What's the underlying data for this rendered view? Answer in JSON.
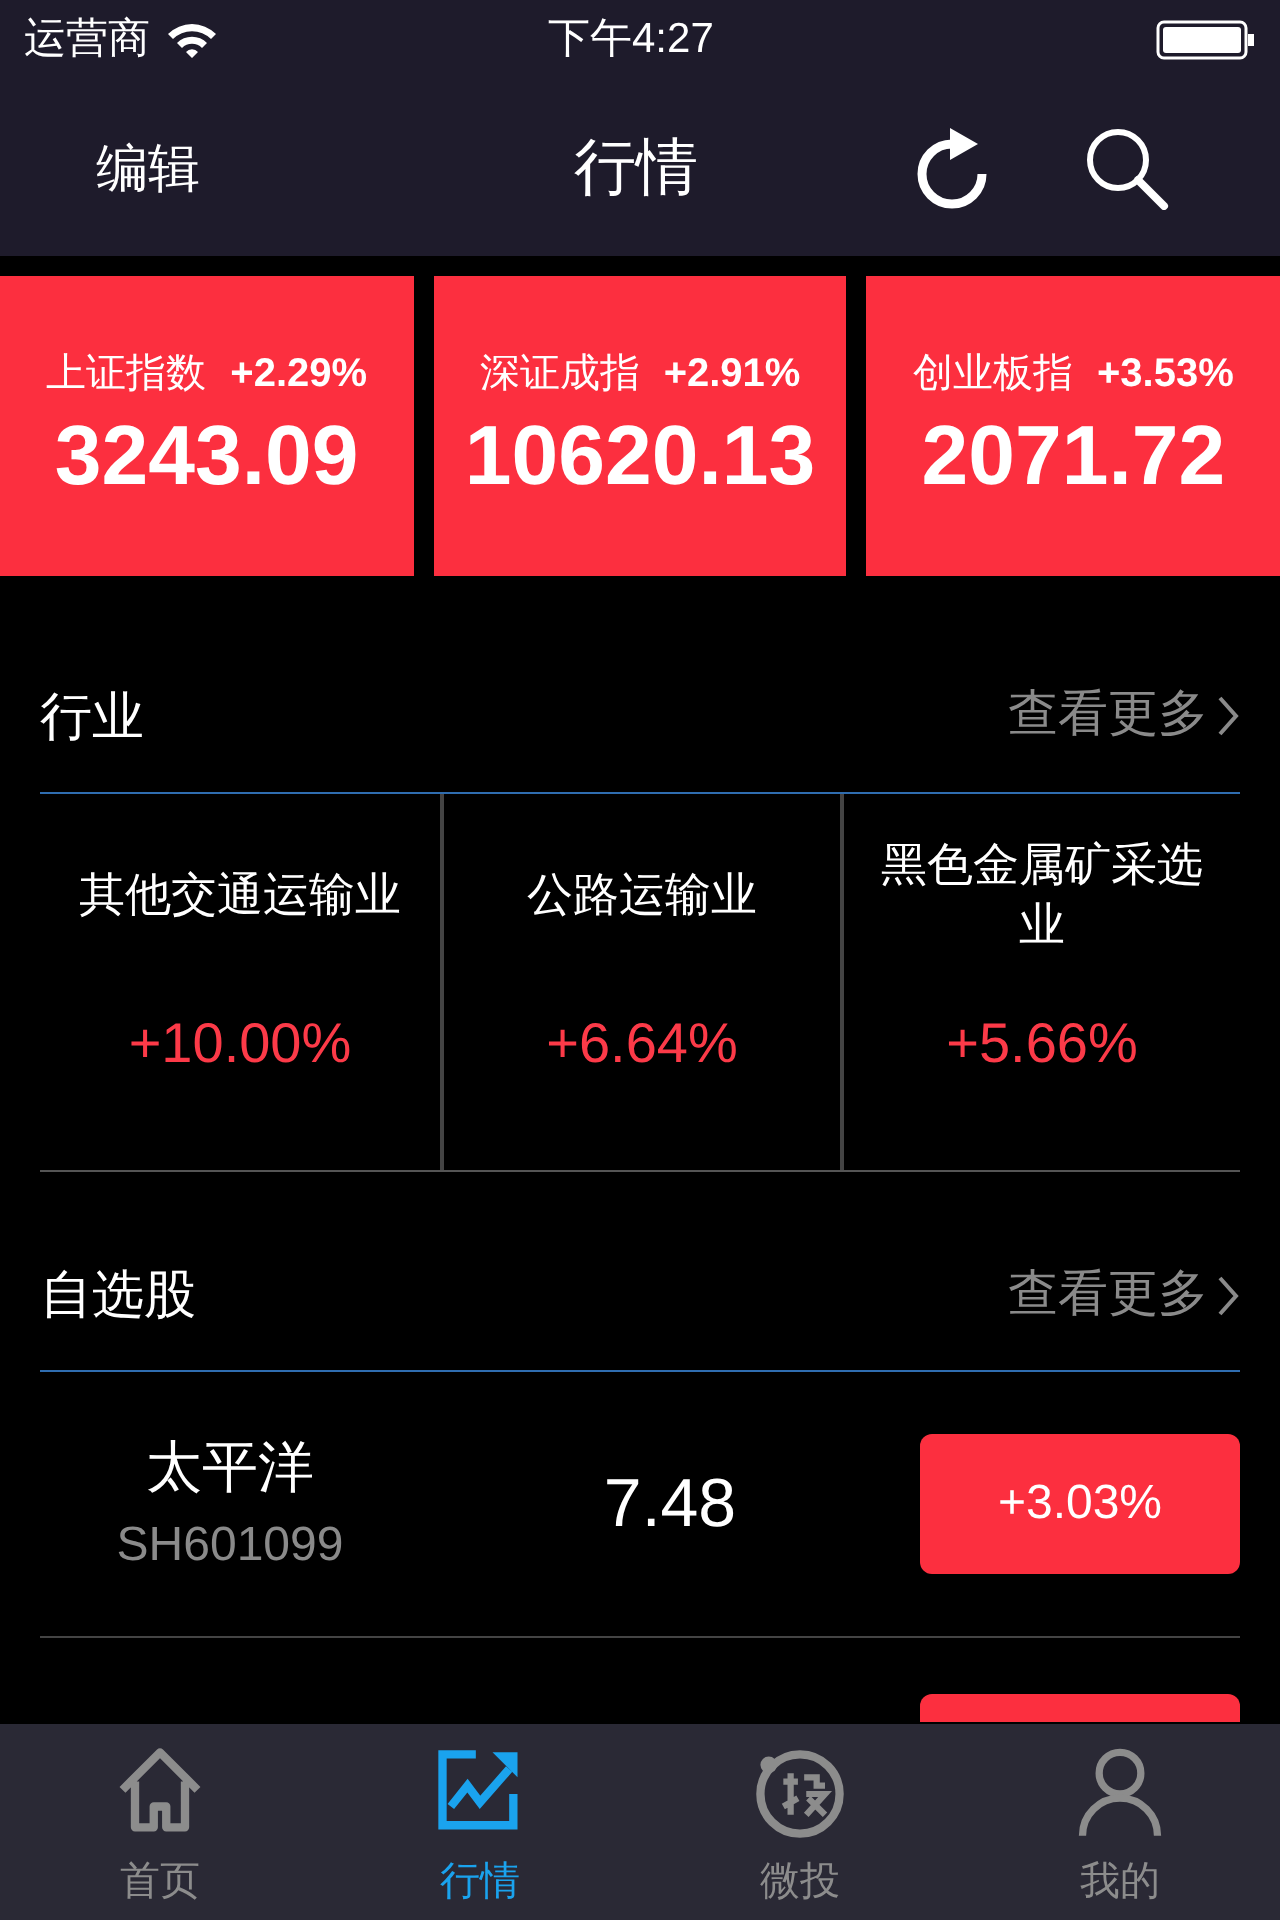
{
  "status_bar": {
    "carrier": "运营商",
    "time": "下午4:27"
  },
  "nav": {
    "left": "编辑",
    "title": "行情"
  },
  "indices": [
    {
      "name": "上证指数",
      "change": "+2.29%",
      "value": "3243.09"
    },
    {
      "name": "深证成指",
      "change": "+2.91%",
      "value": "10620.13"
    },
    {
      "name": "创业板指",
      "change": "+3.53%",
      "value": "2071.72"
    }
  ],
  "industry": {
    "title": "行业",
    "more": "查看更多",
    "items": [
      {
        "name": "其他交通运输业",
        "change": "+10.00%"
      },
      {
        "name": "公路运输业",
        "change": "+6.64%"
      },
      {
        "name": "黑色金属矿采选业",
        "change": "+5.66%"
      }
    ]
  },
  "watchlist": {
    "title": "自选股",
    "more": "查看更多",
    "rows": [
      {
        "kind": "full",
        "name": "太平洋",
        "code": "SH601099",
        "price": "7.48",
        "change": "+3.03%"
      },
      {
        "kind": "peek"
      }
    ]
  },
  "tab_bar": [
    {
      "label": "首页",
      "kind": "home",
      "selected": false
    },
    {
      "label": "行情",
      "kind": "market",
      "selected": true
    },
    {
      "label": "微投",
      "kind": "invest",
      "selected": false
    },
    {
      "label": "我的",
      "kind": "profile",
      "selected": false
    }
  ]
}
